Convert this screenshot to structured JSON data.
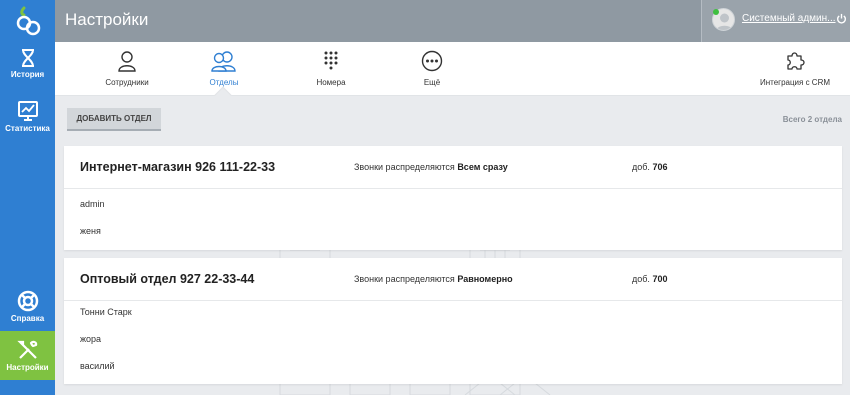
{
  "header": {
    "title": "Настройки",
    "user_name": "Системный админ..."
  },
  "sidebar": {
    "items": [
      {
        "label": "История"
      },
      {
        "label": "Статистика"
      },
      {
        "label": "Справка"
      },
      {
        "label": "Настройки"
      }
    ]
  },
  "tabs": [
    {
      "label": "Сотрудники"
    },
    {
      "label": "Отделы"
    },
    {
      "label": "Номера"
    },
    {
      "label": "Ещё"
    },
    {
      "label": "Интеграция с CRM"
    }
  ],
  "toolbar": {
    "add_label": "ДОБАВИТЬ ОТДЕЛ",
    "total_label": "Всего 2 отдела"
  },
  "departments": [
    {
      "name": "Интернет-магазин 926 111-22-33",
      "dist_prefix": "Звонки распределяются",
      "dist_mode": "Всем сразу",
      "ext_prefix": "доб.",
      "ext": "706",
      "members": [
        "admin",
        "женя"
      ]
    },
    {
      "name": "Оптовый отдел 927 22-33-44",
      "dist_prefix": "Звонки распределяются",
      "dist_mode": "Равномерно",
      "ext_prefix": "доб.",
      "ext": "700",
      "members": [
        "Тонни Старк",
        "жора",
        "василий"
      ]
    }
  ],
  "colors": {
    "sidebar": "#2f7fd2",
    "active_sidebar": "#7fc241",
    "header": "#8f99a2",
    "accent": "#2f7fd2"
  }
}
